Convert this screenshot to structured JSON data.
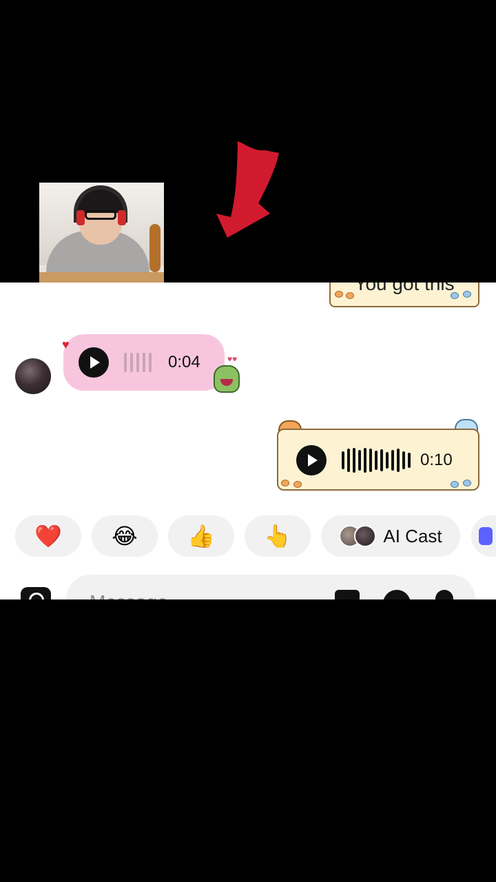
{
  "overlay": {
    "arrow_color": "#d21a2f",
    "pip_description": "webcam-person-icon"
  },
  "chat": {
    "top_sticker_text": "You got this",
    "incoming_voice": {
      "duration": "0:04",
      "reaction": "♥"
    },
    "outgoing_voice": {
      "duration": "0:10"
    }
  },
  "reactions": [
    {
      "emoji": "❤️"
    },
    {
      "emoji": "😂"
    },
    {
      "emoji": "👍"
    },
    {
      "emoji": "👆"
    },
    {
      "label": "AI Cast"
    }
  ],
  "composer": {
    "placeholder": "Message..."
  },
  "colors": {
    "pink_bubble": "#f7c6de",
    "sticker_bg": "#fdf3d3",
    "chip_bg": "#f1f1f1"
  }
}
